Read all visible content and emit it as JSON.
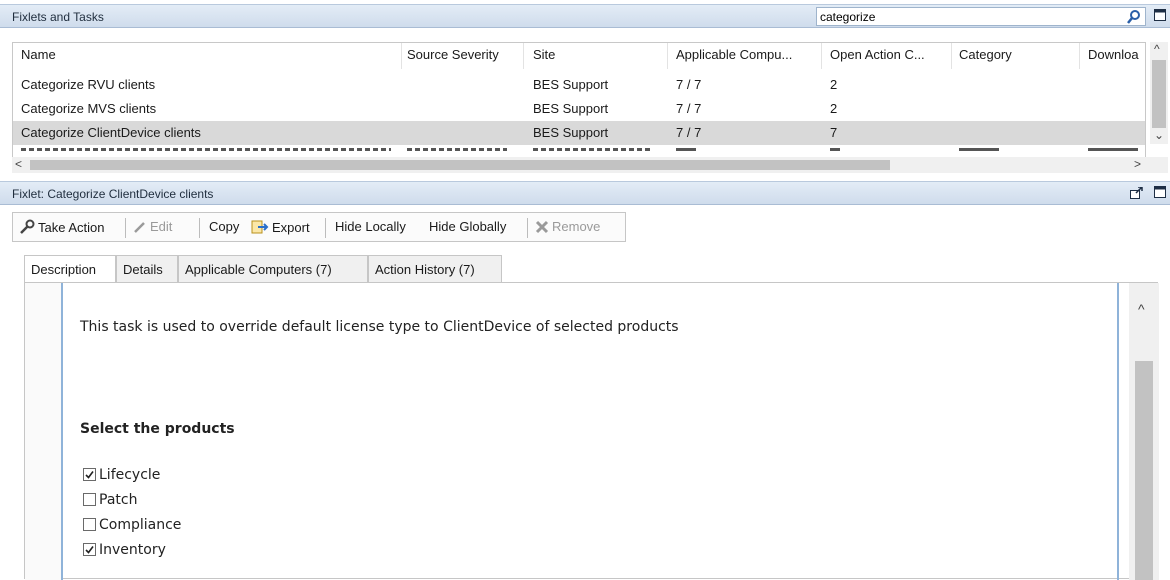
{
  "panels": {
    "fixlets_title": "Fixlets and Tasks",
    "fixlet_title": "Fixlet: Categorize ClientDevice clients"
  },
  "search": {
    "value": "categorize"
  },
  "table": {
    "columns": [
      "Name",
      "Source Severity",
      "Site",
      "Applicable Compu...",
      "Open Action C...",
      "Category",
      "Downloa"
    ],
    "rows": [
      {
        "name": "Categorize RVU clients",
        "severity": "",
        "site": "BES Support",
        "applicable": "7 / 7",
        "open_actions": "2",
        "category": "",
        "download": ""
      },
      {
        "name": "Categorize MVS clients",
        "severity": "",
        "site": "BES Support",
        "applicable": "7 / 7",
        "open_actions": "2",
        "category": "",
        "download": ""
      },
      {
        "name": "Categorize ClientDevice clients",
        "severity": "",
        "site": "BES Support",
        "applicable": "7 / 7",
        "open_actions": "7",
        "category": "",
        "download": "",
        "selected": true
      }
    ]
  },
  "toolbar": {
    "take_action": "Take Action",
    "edit": "Edit",
    "copy": "Copy",
    "export": "Export",
    "hide_locally": "Hide Locally",
    "hide_globally": "Hide Globally",
    "remove": "Remove"
  },
  "tabs": [
    "Description",
    "Details",
    "Applicable Computers (7)",
    "Action History (7)"
  ],
  "description": {
    "text": "This task is used to override default license type to ClientDevice of selected products",
    "heading": "Select the products",
    "products": [
      {
        "label": "Lifecycle",
        "checked": true
      },
      {
        "label": "Patch",
        "checked": false
      },
      {
        "label": "Compliance",
        "checked": false
      },
      {
        "label": "Inventory",
        "checked": true
      }
    ]
  },
  "colors": {
    "panel_header": "#d6e2f0",
    "selected_row": "#d9d9d9",
    "accent_line": "#8fb3d9"
  }
}
